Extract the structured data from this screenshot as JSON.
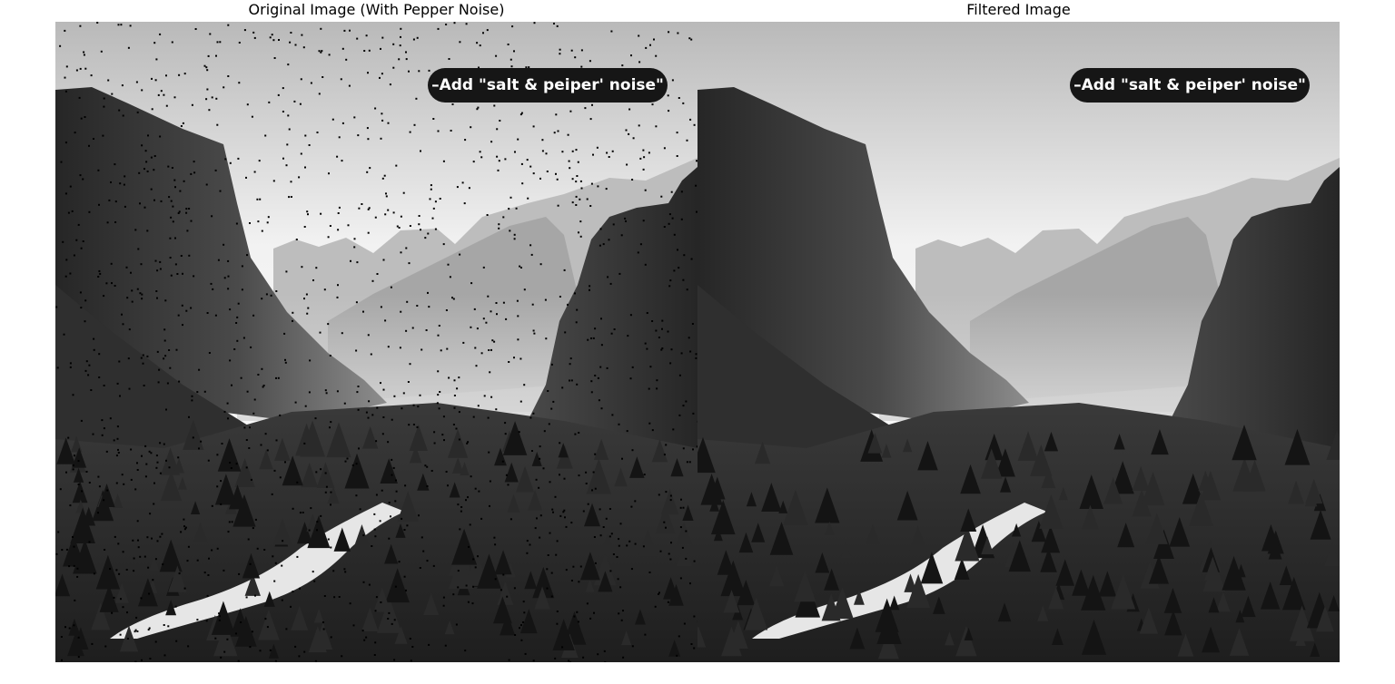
{
  "panels": [
    {
      "title": "Original Image (With Pepper Noise)",
      "image_caption": "–Add \"salt & peiper' noise\"",
      "noise": true
    },
    {
      "title": "Filtered Image",
      "image_caption": "–Add \"salt & peiper' noise\"",
      "noise": false
    }
  ],
  "scene": {
    "description_icon": "mountain-valley-landscape",
    "palette": {
      "sky": "#f2f2f2",
      "sky_top": "#b9b9b9",
      "cliff": "#4a4a4a",
      "cliff_dark": "#262626",
      "distant": "#bdbdbd",
      "mist": "#d9d9d9",
      "forest": "#1e1e1e",
      "river": "#e6e6e6",
      "pill": "#161616",
      "pepper": "#000000"
    }
  }
}
